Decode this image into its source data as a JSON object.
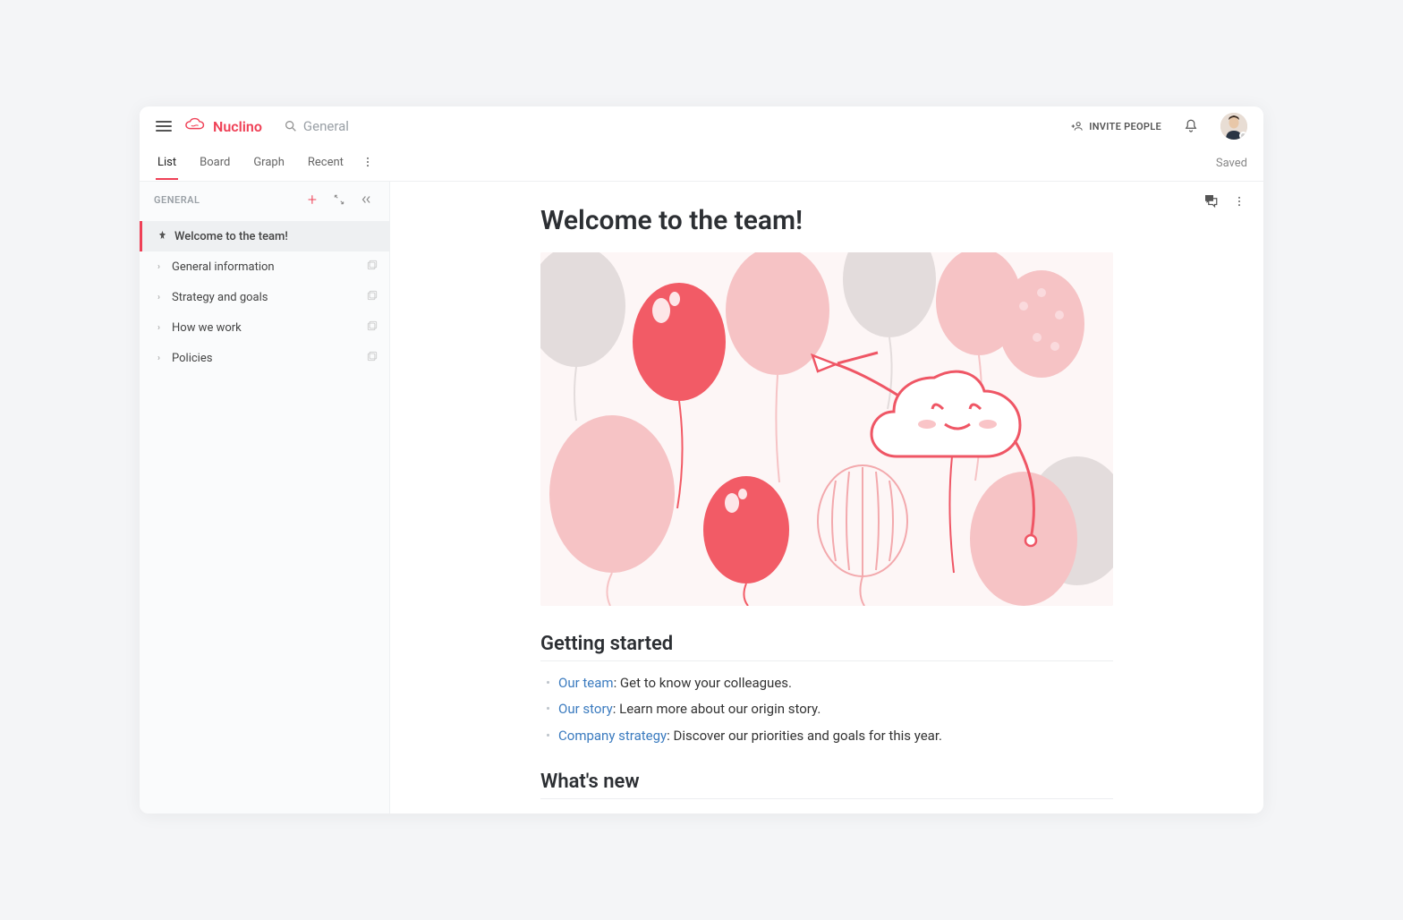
{
  "brand": {
    "name": "Nuclino"
  },
  "search": {
    "placeholder": "General"
  },
  "header": {
    "invite": "INVITE PEOPLE",
    "saved": "Saved"
  },
  "tabs": {
    "items": [
      "List",
      "Board",
      "Graph",
      "Recent"
    ],
    "active": 0
  },
  "sidebar": {
    "heading": "GENERAL",
    "items": [
      {
        "label": "Welcome to the team!",
        "pinned": true,
        "active": true,
        "hasChildren": false
      },
      {
        "label": "General information",
        "hasChildren": true
      },
      {
        "label": "Strategy and goals",
        "hasChildren": true
      },
      {
        "label": "How we work",
        "hasChildren": true
      },
      {
        "label": "Policies",
        "hasChildren": true
      }
    ]
  },
  "document": {
    "title": "Welcome to the team!",
    "section1": {
      "heading": "Getting started"
    },
    "bullets": [
      {
        "link": "Our team",
        "rest": ": Get to know your colleagues."
      },
      {
        "link": "Our story",
        "rest": ": Learn more about our origin story."
      },
      {
        "link": "Company strategy",
        "rest": ": Discover our priorities and goals for this year."
      }
    ],
    "section2": {
      "heading": "What's new"
    }
  },
  "colors": {
    "accent": "#ef4056",
    "link": "#3b7bbf"
  }
}
